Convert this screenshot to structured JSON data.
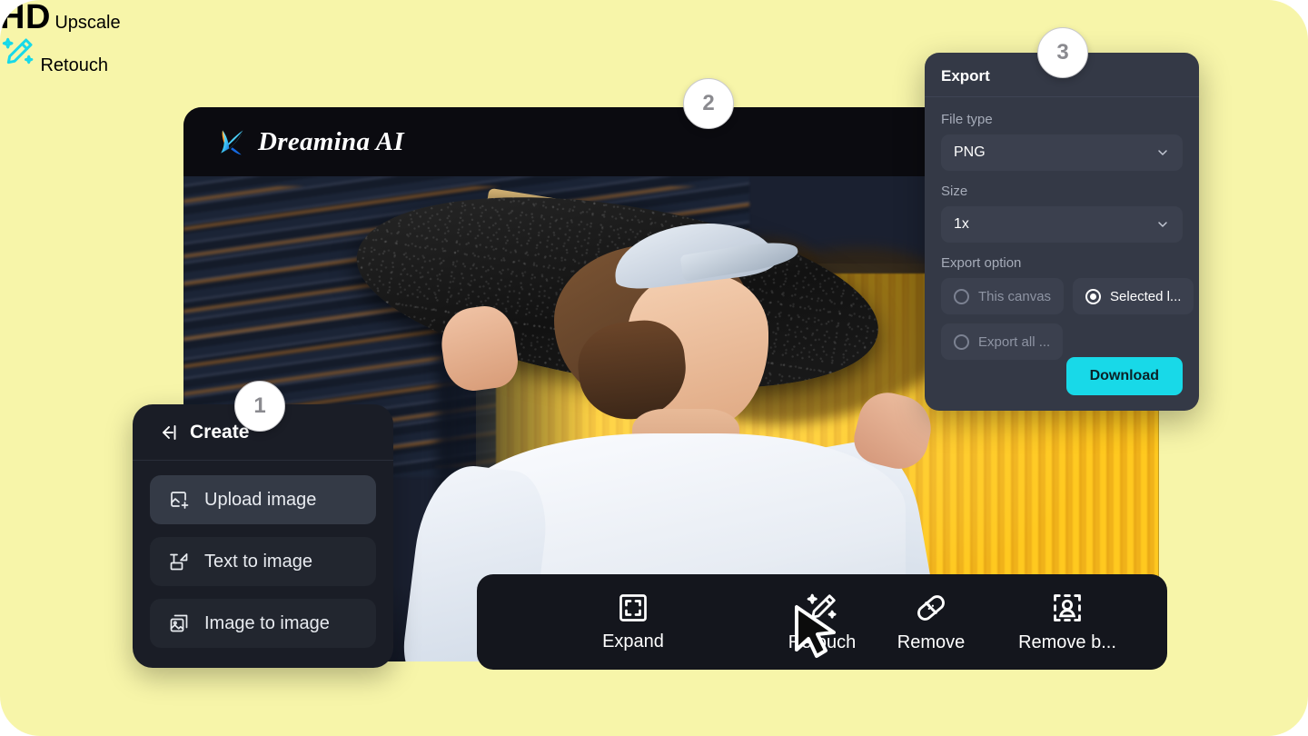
{
  "app": {
    "brand_name": "Dreamina AI",
    "logo_icon": "four-point-star-icon"
  },
  "colors": {
    "page_background": "#F7F5A9",
    "accent_cyan": "#18D9E8",
    "panel_dark": "#1A1D26",
    "export_panel": "#343946",
    "toolbar": "#14161D"
  },
  "badges": [
    {
      "number": "1"
    },
    {
      "number": "2"
    },
    {
      "number": "3"
    }
  ],
  "create_panel": {
    "back_icon": "collapse-left-icon",
    "title": "Create",
    "items": [
      {
        "label": "Upload image",
        "icon": "upload-image-icon",
        "active": true
      },
      {
        "label": "Text to image",
        "icon": "text-to-image-icon",
        "active": false
      },
      {
        "label": "Image to image",
        "icon": "image-to-image-icon",
        "active": false
      }
    ]
  },
  "export_panel": {
    "title": "Export",
    "file_type": {
      "label": "File type",
      "value": "PNG",
      "chevron_icon": "chevron-down-icon"
    },
    "size": {
      "label": "Size",
      "value": "1x",
      "chevron_icon": "chevron-down-icon"
    },
    "export_option": {
      "label": "Export option",
      "options": [
        {
          "label": "This canvas",
          "selected": false
        },
        {
          "label": "Selected l...",
          "selected": true
        },
        {
          "label": "Export all ...",
          "selected": false
        }
      ]
    },
    "download_label": "Download"
  },
  "toolbar": {
    "tools": [
      {
        "label": "Upscale",
        "icon": "hd-icon",
        "highlighted": true,
        "badge_text": "HD"
      },
      {
        "label": "Expand",
        "icon": "expand-icon",
        "highlighted": false
      },
      {
        "label": "Retouch",
        "icon": "magic-pencil-icon",
        "highlighted": true
      },
      {
        "label": "Retouch",
        "icon": "magic-pencil-icon",
        "highlighted": false
      },
      {
        "label": "Remove",
        "icon": "bandage-icon",
        "highlighted": false
      },
      {
        "label": "Remove b...",
        "icon": "remove-background-icon",
        "highlighted": false
      }
    ]
  },
  "cursor": {
    "icon": "mouse-pointer-icon"
  }
}
